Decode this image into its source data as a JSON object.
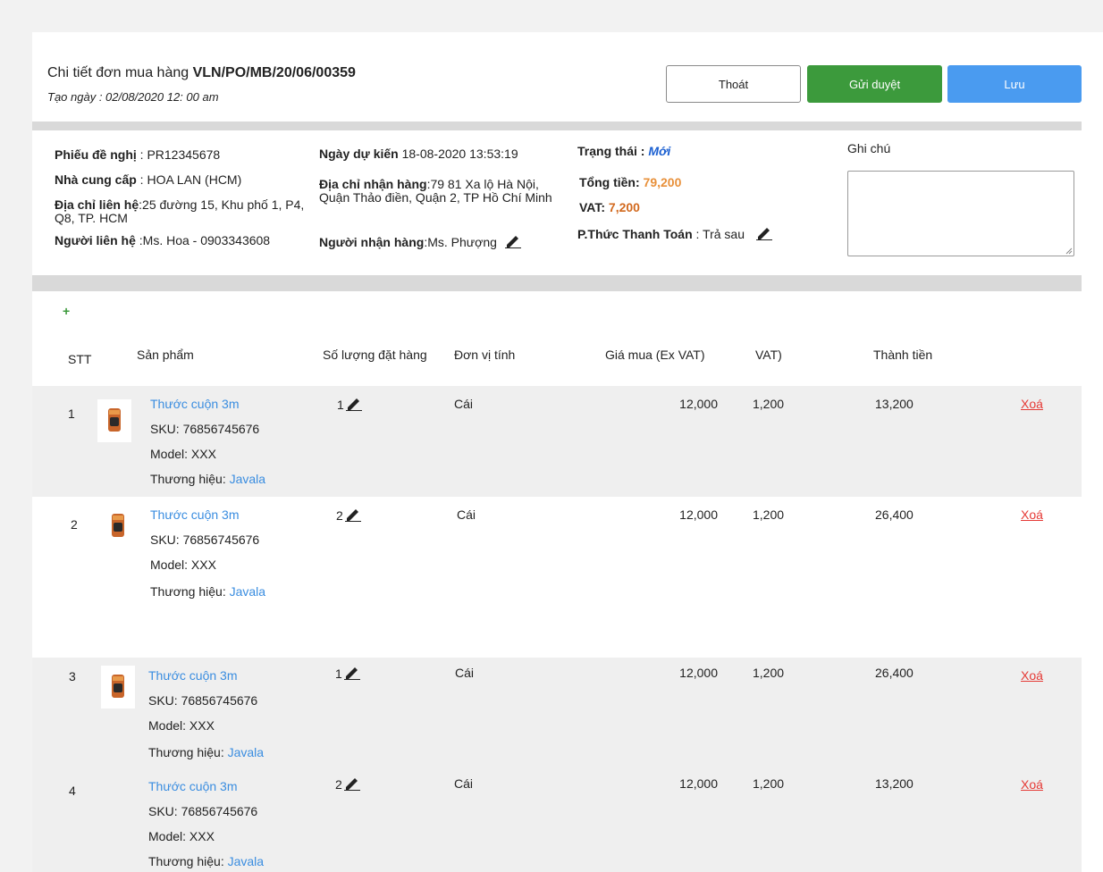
{
  "header": {
    "title_prefix": "Chi tiết đơn mua hàng ",
    "po_number": "VLN/PO/MB/20/06/00359",
    "created": "Tạo ngày : 02/08/2020 12: 00 am",
    "btn_exit": "Thoát",
    "btn_send": "Gửi duyệt",
    "btn_save": "Lưu"
  },
  "info": {
    "request_label": "Phiếu đề nghị",
    "request_value": " : PR12345678",
    "supplier_label": "Nhà cung cấp",
    "supplier_value": " : HOA LAN (HCM)",
    "contact_addr_label": "Địa chỉ liên hệ",
    "contact_addr_value": ":25 đường 15, Khu phố 1, P4, Q8, TP. HCM",
    "contact_person_label": "Người liên hệ",
    "contact_person_value": " :Ms. Hoa - 0903343608",
    "expected_date_label": "Ngày dự kiến",
    "expected_date_value": " 18-08-2020 13:53:19",
    "delivery_addr_label": "Địa chỉ nhận hàng",
    "delivery_addr_value": ":79 81 Xa lộ Hà Nội, Quận Thảo điền, Quận 2, TP Hồ Chí Minh",
    "receiver_label": "Người nhận hàng",
    "receiver_value": ":Ms. Phượng",
    "status_label": "Trạng thái : ",
    "status_value": "Mới",
    "total_label": "Tổng tiền: ",
    "total_value": "79,200",
    "vat_label": "VAT: ",
    "vat_value": "7,200",
    "payment_label": "P.Thức Thanh Toán",
    "payment_value": " : Trả sau",
    "notes_label": "Ghi chú",
    "notes_value": ""
  },
  "table": {
    "add_label": "+",
    "headers": {
      "stt": "STT",
      "product": "Sản phẩm",
      "qty": "Số lượng đặt hàng",
      "unit": "Đơn vị tính",
      "price": "Giá mua (Ex VAT)",
      "vat": "VAT)",
      "total": "Thành tiền"
    },
    "rows": [
      {
        "stt": "1",
        "name": "Thước cuộn 3m",
        "sku": "SKU: 76856745676",
        "model": "Model: XXX",
        "brand_label": "Thương hiệu: ",
        "brand": "Javala",
        "qty": "1",
        "unit": "Cái",
        "price": "12,000",
        "vat": "1,200",
        "total": "13,200",
        "delete": "Xoá"
      },
      {
        "stt": "2",
        "name": "Thước cuộn 3m",
        "sku": "SKU: 76856745676",
        "model": "Model: XXX",
        "brand_label": "Thương hiệu: ",
        "brand": "Javala",
        "qty": "2",
        "unit": "Cái",
        "price": "12,000",
        "vat": "1,200",
        "total": "26,400",
        "delete": "Xoá"
      },
      {
        "stt": "3",
        "name": "Thước cuộn 3m",
        "sku": "SKU: 76856745676",
        "model": "Model: XXX",
        "brand_label": "Thương hiệu: ",
        "brand": "Javala",
        "qty": "1",
        "unit": "Cái",
        "price": "12,000",
        "vat": "1,200",
        "total": "26,400",
        "delete": "Xoá"
      },
      {
        "stt": "4",
        "name": "Thước cuộn 3m",
        "sku": "SKU: 76856745676",
        "model": "Model: XXX",
        "brand_label": "Thương hiệu: ",
        "brand": "Javala",
        "qty": "2",
        "unit": "Cái",
        "price": "12,000",
        "vat": "1,200",
        "total": "13,200",
        "delete": "Xoá"
      }
    ]
  },
  "colors": {
    "send_button": "#3c9a3c",
    "save_button": "#4a9bf0",
    "link": "#3a8de0",
    "delete": "#e53935",
    "total_amount": "#e8903a"
  }
}
